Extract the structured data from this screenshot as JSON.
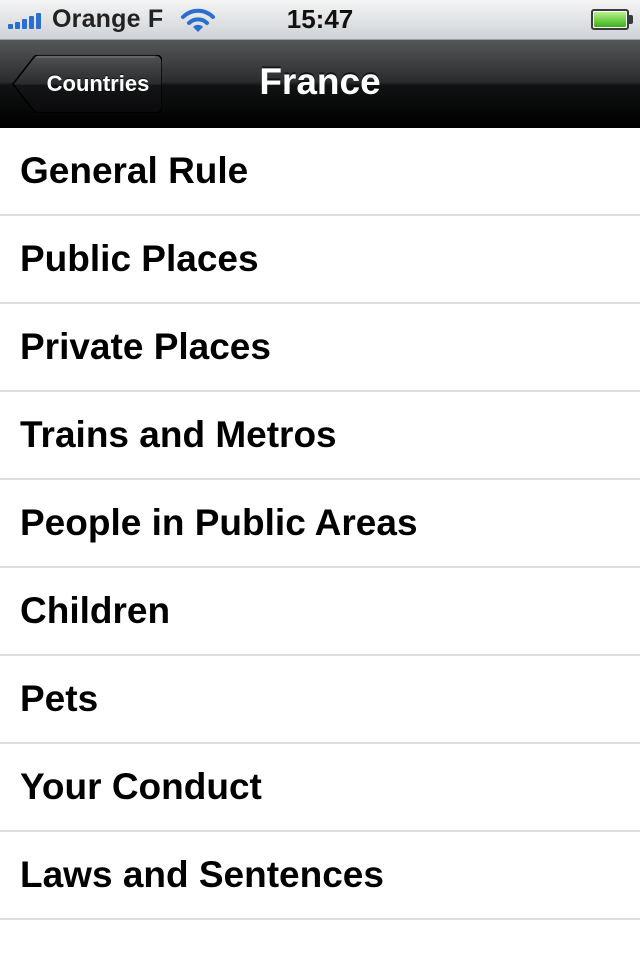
{
  "status_bar": {
    "carrier": "Orange F",
    "time": "15:47",
    "signal_icon": "signal-bars-icon",
    "wifi_icon": "wifi-icon",
    "battery_icon": "battery-icon",
    "battery_level": 1.0,
    "accent_color": "#2a6fcf"
  },
  "nav": {
    "back_label": "Countries",
    "title": "France"
  },
  "list": {
    "items": [
      {
        "label": "General Rule"
      },
      {
        "label": "Public Places"
      },
      {
        "label": "Private Places"
      },
      {
        "label": "Trains and Metros"
      },
      {
        "label": "People in Public Areas"
      },
      {
        "label": "Children"
      },
      {
        "label": "Pets"
      },
      {
        "label": "Your Conduct"
      },
      {
        "label": "Laws and Sentences"
      }
    ]
  }
}
